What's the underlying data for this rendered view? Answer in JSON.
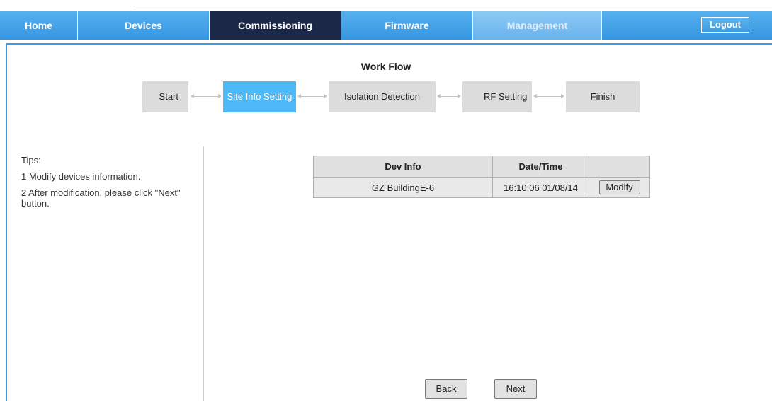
{
  "nav": {
    "tabs": [
      {
        "label": "Home"
      },
      {
        "label": "Devices"
      },
      {
        "label": "Commissioning"
      },
      {
        "label": "Firmware"
      },
      {
        "label": "Management"
      }
    ],
    "logout_label": "Logout",
    "active_tab": "Commissioning",
    "colors": {
      "bar": "#3f9be0",
      "active": "#1c2847",
      "current_step": "#4db9f6"
    }
  },
  "workflow": {
    "title": "Work Flow",
    "steps": [
      "Start",
      "Site Info Setting",
      "Isolation Detection",
      "RF Setting",
      "Finish"
    ],
    "current_step": "Site Info Setting"
  },
  "tips": {
    "heading": "Tips:",
    "items": [
      "1 Modify devices information.",
      "2 After modification, please click \"Next\" button."
    ]
  },
  "table": {
    "headers": [
      "Dev Info",
      "Date/Time",
      ""
    ],
    "rows": [
      {
        "dev_info": "GZ BuildingE-6",
        "datetime": "16:10:06 01/08/14",
        "action": "Modify"
      }
    ]
  },
  "buttons": {
    "back": "Back",
    "next": "Next"
  }
}
